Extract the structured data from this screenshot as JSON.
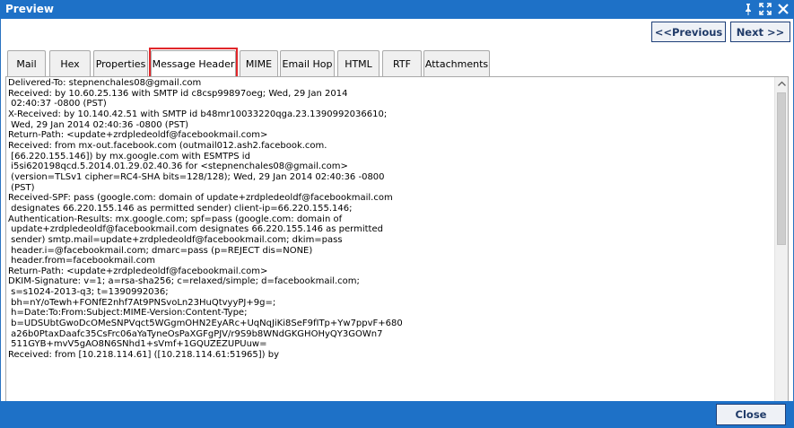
{
  "window": {
    "title": "Preview",
    "controls": [
      "pin-icon",
      "expand-icon",
      "close-icon"
    ],
    "accent_color": "#1e71c7"
  },
  "nav": {
    "previous_label": "<<Previous",
    "next_label": "Next >>"
  },
  "tabs": [
    {
      "label": "Mail"
    },
    {
      "label": "Hex"
    },
    {
      "label": "Properties"
    },
    {
      "label": "Message Header",
      "active": true,
      "highlight_color": "#e0262a"
    },
    {
      "label": "MIME"
    },
    {
      "label": "Email Hop"
    },
    {
      "label": "HTML"
    },
    {
      "label": "RTF"
    },
    {
      "label": "Attachments"
    }
  ],
  "header_lines": [
    "Delivered-To: stepnenchales08@gmail.com",
    "Received: by 10.60.25.136 with SMTP id c8csp99897oeg; Wed, 29 Jan 2014",
    " 02:40:37 -0800 (PST)",
    "X-Received: by 10.140.42.51 with SMTP id b48mr10033220qga.23.1390992036610;",
    " Wed, 29 Jan 2014 02:40:36 -0800 (PST)",
    "Return-Path: <update+zrdpledeoldf@facebookmail.com>",
    "Received: from mx-out.facebook.com (outmail012.ash2.facebook.com.",
    " [66.220.155.146]) by mx.google.com with ESMTPS id",
    " i5si620198qcd.5.2014.01.29.02.40.36 for <stepnenchales08@gmail.com>",
    " (version=TLSv1 cipher=RC4-SHA bits=128/128); Wed, 29 Jan 2014 02:40:36 -0800",
    " (PST)",
    "Received-SPF: pass (google.com: domain of update+zrdpledeoldf@facebookmail.com",
    " designates 66.220.155.146 as permitted sender) client-ip=66.220.155.146;",
    "Authentication-Results: mx.google.com; spf=pass (google.com: domain of",
    " update+zrdpledeoldf@facebookmail.com designates 66.220.155.146 as permitted",
    " sender) smtp.mail=update+zrdpledeoldf@facebookmail.com; dkim=pass",
    " header.i=@facebookmail.com; dmarc=pass (p=REJECT dis=NONE)",
    " header.from=facebookmail.com",
    "Return-Path: <update+zrdpledeoldf@facebookmail.com>",
    "DKIM-Signature: v=1; a=rsa-sha256; c=relaxed/simple; d=facebookmail.com;",
    " s=s1024-2013-q3; t=1390992036;",
    " bh=nY/oTewh+FONfE2nhf7At9PNSvoLn23HuQtvyyPJ+9g=;",
    " h=Date:To:From:Subject:MIME-Version:Content-Type;",
    " b=UDSUbtGwoDcOMeSNPVqct5WGgmOHN2EyARc+UqNqJiKi8SeF9fITp+Yw7ppvF+680",
    " a26b0PtaxDaafc35CsFrc06aYaTyneOsPaXGFgPJV/r9S9b8WNdGKGHOHyQY3GOWn7",
    " 511GYB+mvV5gAO8N6SNhd1+sVmf+1GQUZEZUPUuw=",
    "Received: from [10.218.114.61] ([10.218.114.61:51965]) by"
  ],
  "footer": {
    "close_label": "Close"
  }
}
